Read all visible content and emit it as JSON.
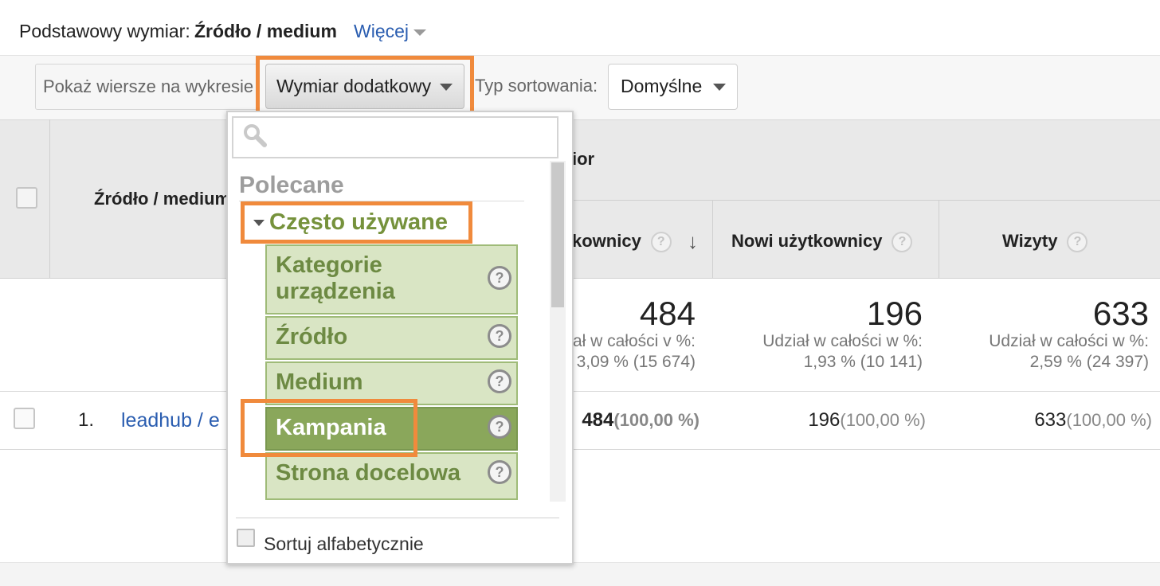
{
  "header": {
    "primary_dimension_label": "Podstawowy wymiar:",
    "primary_dimension_value": "Źródło / medium",
    "more_label": "Więcej"
  },
  "toolbar": {
    "plot_rows_label": "Pokaż wiersze na wykresie",
    "secondary_dimension_label": "Wymiar dodatkowy",
    "sort_type_label": "Typ sortowania:",
    "sort_type_value": "Domyślne"
  },
  "table": {
    "source_column": "Źródło / medium",
    "group_header": "ior",
    "columns": [
      {
        "label": "kownicy"
      },
      {
        "label": "Nowi użytkownicy"
      },
      {
        "label": "Wizyty"
      }
    ],
    "totals": [
      {
        "value": "484",
        "sub1": "ał w całości v %:",
        "sub2": "3,09 % (15 674)"
      },
      {
        "value": "196",
        "sub1": "Udział w całości w %:",
        "sub2": "1,93 % (10 141)"
      },
      {
        "value": "633",
        "sub1": "Udział w całości w %:",
        "sub2": "2,59 % (24 397)"
      }
    ],
    "rows": [
      {
        "index": "1.",
        "source_visible": "leadhub / e",
        "cells": [
          {
            "value": "484",
            "pct": "(100,00 %)"
          },
          {
            "value": "196",
            "pct": "(100,00 %)"
          },
          {
            "value": "633",
            "pct": "(100,00 %)"
          }
        ]
      }
    ]
  },
  "dropdown": {
    "search_placeholder": "",
    "section_title": "Polecane",
    "group_title": "Często używane",
    "items": [
      {
        "label": "Kategorie urządzenia"
      },
      {
        "label": "Źródło"
      },
      {
        "label": "Medium"
      },
      {
        "label": "Kampania"
      },
      {
        "label": "Strona docelowa"
      }
    ],
    "sort_alpha_label": "Sortuj alfabetycznie"
  },
  "colors": {
    "highlight": "#f08a3c",
    "link": "#2a5db0",
    "item_bg": "#d9e5c4",
    "item_selected_bg": "#8aa75b"
  }
}
